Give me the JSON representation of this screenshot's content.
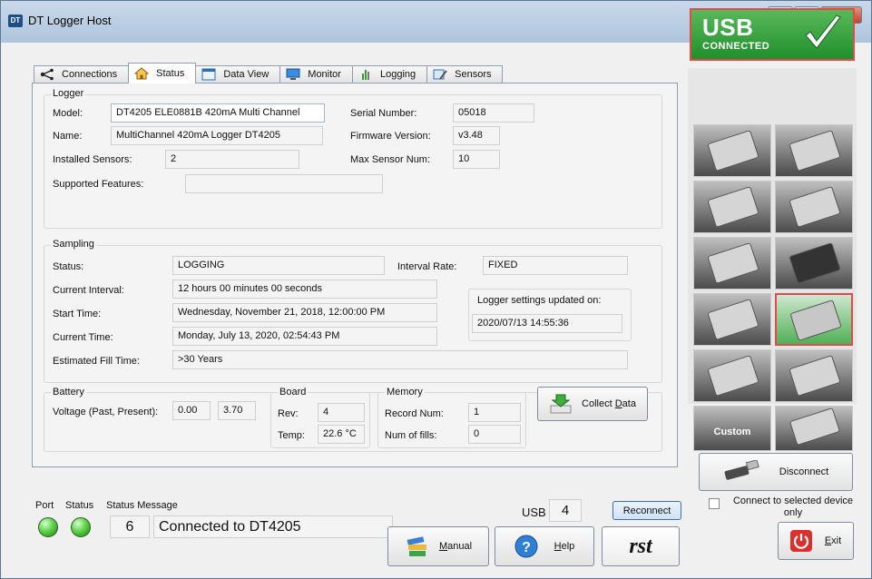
{
  "window": {
    "title": "DT Logger Host",
    "app_icon_text": "DT"
  },
  "tabs": [
    {
      "label": "Connections",
      "icon": "connections-icon"
    },
    {
      "label": "Status",
      "icon": "home-icon"
    },
    {
      "label": "Data View",
      "icon": "data-view-icon"
    },
    {
      "label": "Monitor",
      "icon": "monitor-icon"
    },
    {
      "label": "Logging",
      "icon": "logging-icon"
    },
    {
      "label": "Sensors",
      "icon": "sensors-icon"
    }
  ],
  "active_tab": "Status",
  "logger": {
    "title": "Logger",
    "model_label": "Model:",
    "model_value": "DT4205 ELE0881B 420mA Multi Channel",
    "name_label": "Name:",
    "name_value": "MultiChannel 420mA Logger DT4205",
    "installed_label": "Installed Sensors:",
    "installed_value": "2",
    "features_label": "Supported Features:",
    "features_value": "",
    "serial_label": "Serial Number:",
    "serial_value": "05018",
    "firmware_label": "Firmware Version:",
    "firmware_value": "v3.48",
    "max_sensor_label": "Max Sensor Num:",
    "max_sensor_value": "10"
  },
  "sampling": {
    "title": "Sampling",
    "status_label": "Status:",
    "status_value": "LOGGING",
    "interval_rate_label": "Interval Rate:",
    "interval_rate_value": "FIXED",
    "current_interval_label": "Current Interval:",
    "current_interval_value": "12 hours  00 minutes  00 seconds",
    "start_time_label": "Start Time:",
    "start_time_value": "Wednesday,  November 21,  2018,  12:00:00 PM",
    "current_time_label": "Current Time:",
    "current_time_value": "Monday,  July 13,  2020,  02:54:43 PM",
    "fill_time_label": "Estimated Fill Time:",
    "fill_time_value": ">30 Years",
    "updated_label": "Logger settings updated on:",
    "updated_value": "2020/07/13 14:55:36"
  },
  "battery": {
    "title": "Battery",
    "voltage_label": "Voltage (Past, Present):",
    "past_value": "0.00",
    "present_value": "3.70"
  },
  "board": {
    "title": "Board",
    "rev_label": "Rev:",
    "rev_value": "4",
    "temp_label": "Temp:",
    "temp_value": "22.6 °C"
  },
  "memory": {
    "title": "Memory",
    "record_label": "Record Num:",
    "record_value": "1",
    "fills_label": "Num of fills:",
    "fills_value": "0"
  },
  "collect_button": {
    "label_pre": "Collect ",
    "label_u": "D",
    "label_post": "ata"
  },
  "status_bar": {
    "port_label": "Port",
    "status_label": "Status",
    "message_label": "Status Message",
    "message_number": "6",
    "message_text": "Connected to DT4205",
    "usb_label": "USB",
    "usb_value": "4",
    "reconnect_label": "Reconnect"
  },
  "buttons": {
    "manual_u": "M",
    "manual_rest": "anual",
    "help_u": "H",
    "help_rest": "elp",
    "disconnect_label": "Disconnect",
    "exit_u": "E",
    "exit_rest": "xit",
    "rst_logo": "rst"
  },
  "connect_selected": {
    "label": "Connect to selected device only",
    "checked": false
  },
  "usb_badge": {
    "line1": "USB",
    "line2": "CONNECTED"
  },
  "devices": {
    "custom_label": "Custom",
    "selected_index": 7
  },
  "colors": {
    "accent_green": "#1f8f2c",
    "selected_border": "#e04a4a",
    "exit_red": "#d9302c"
  }
}
